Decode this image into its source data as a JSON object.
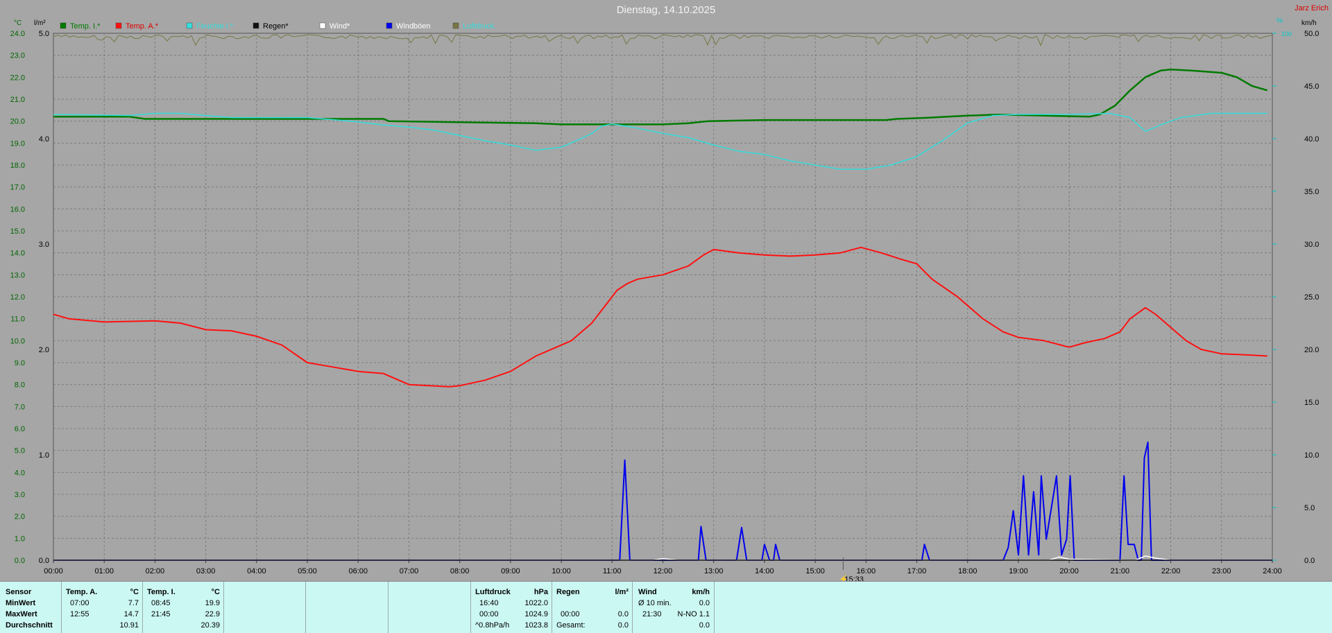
{
  "title": "Dienstag, 14.10.2025",
  "station": "Jarz Erich",
  "colors": {
    "background": "#a6a6a6",
    "temp_i": "#007a00",
    "temp_a": "#ff1010",
    "humidity": "#33dddd",
    "rain": "#111111",
    "wind": "#ffffff",
    "gusts": "#0000ee",
    "pressure": "#777744",
    "left_axis": "#006600",
    "rain_axis": "#000000",
    "right_axis": "#00c8c8",
    "station": "#dd0000"
  },
  "chart_data": {
    "type": "line",
    "axes": {
      "temp_unit": "°C",
      "temp_range": [
        0,
        24
      ],
      "rain_unit": "l/m²",
      "rain_range": [
        0,
        5
      ],
      "hum_unit": "%",
      "hum_range_label": "100",
      "wind_unit": "km/h",
      "wind_range": [
        0,
        50
      ],
      "temp_ticks": [
        "0.0",
        "1.0",
        "2.0",
        "3.0",
        "4.0",
        "5.0",
        "6.0",
        "7.0",
        "8.0",
        "9.0",
        "10.0",
        "11.0",
        "12.0",
        "13.0",
        "14.0",
        "15.0",
        "16.0",
        "17.0",
        "18.0",
        "19.0",
        "20.0",
        "21.0",
        "22.0",
        "23.0",
        "24.0"
      ],
      "rain_ticks": [
        "0.0",
        "1.0",
        "2.0",
        "3.0",
        "4.0",
        "5.0"
      ],
      "wind_ticks": [
        "0.0",
        "5.0",
        "10.0",
        "15.0",
        "20.0",
        "25.0",
        "30.0",
        "35.0",
        "40.0",
        "45.0",
        "50.0"
      ],
      "x_ticks": [
        "00:00",
        "01:00",
        "02:00",
        "03:00",
        "04:00",
        "05:00",
        "06:00",
        "07:00",
        "08:00",
        "09:00",
        "10:00",
        "11:00",
        "12:00",
        "13:00",
        "14:00",
        "15:00",
        "16:00",
        "17:00",
        "18:00",
        "19:00",
        "20:00",
        "21:00",
        "22:00",
        "23:00",
        "24:00"
      ],
      "x_range": [
        0,
        24
      ],
      "grid": true
    },
    "legend": [
      {
        "label": "Temp. I.*",
        "color": "#007a00",
        "text_color": "#007a00"
      },
      {
        "label": "Temp. A.*",
        "color": "#ff1010",
        "text_color": "#dd0000"
      },
      {
        "label": "Feuchte I.*",
        "color": "#33dddd",
        "text_color": "#33dddd"
      },
      {
        "label": "Regen*",
        "color": "#111111",
        "text_color": "#000000"
      },
      {
        "label": "Wind*",
        "color": "#ffffff",
        "text_color": "#ffffff"
      },
      {
        "label": "Windböen",
        "color": "#0000ee",
        "text_color": "#ffffff"
      },
      {
        "label": "Luftdruck",
        "color": "#777744",
        "text_color": "#33dddd"
      }
    ],
    "marker": {
      "label": "15:33",
      "x": 15.55
    },
    "series": [
      {
        "name": "Temp. I.*",
        "axis": "temp",
        "color": "#007a00",
        "width": 2.5,
        "points": [
          [
            0,
            20.2
          ],
          [
            1.5,
            20.2
          ],
          [
            1.8,
            20.1
          ],
          [
            3,
            20.1
          ],
          [
            6.5,
            20.1
          ],
          [
            6.6,
            20.0
          ],
          [
            8,
            19.95
          ],
          [
            9.5,
            19.9
          ],
          [
            10,
            19.85
          ],
          [
            11,
            19.85
          ],
          [
            12,
            19.85
          ],
          [
            12.5,
            19.9
          ],
          [
            12.9,
            20.0
          ],
          [
            14,
            20.05
          ],
          [
            16,
            20.05
          ],
          [
            16.4,
            20.05
          ],
          [
            16.6,
            20.1
          ],
          [
            17.2,
            20.15
          ],
          [
            18,
            20.25
          ],
          [
            18.6,
            20.3
          ],
          [
            19.5,
            20.25
          ],
          [
            20.4,
            20.2
          ],
          [
            20.6,
            20.3
          ],
          [
            20.9,
            20.7
          ],
          [
            21.2,
            21.4
          ],
          [
            21.5,
            22.0
          ],
          [
            21.8,
            22.3
          ],
          [
            22,
            22.35
          ],
          [
            22.4,
            22.3
          ],
          [
            23,
            22.2
          ],
          [
            23.3,
            22.0
          ],
          [
            23.6,
            21.6
          ],
          [
            23.9,
            21.4
          ]
        ]
      },
      {
        "name": "Temp. A.*",
        "axis": "temp",
        "color": "#ff1010",
        "width": 2,
        "points": [
          [
            0,
            11.2
          ],
          [
            0.3,
            11.0
          ],
          [
            1,
            10.85
          ],
          [
            2,
            10.9
          ],
          [
            2.5,
            10.8
          ],
          [
            3,
            10.5
          ],
          [
            3.5,
            10.45
          ],
          [
            4,
            10.2
          ],
          [
            4.5,
            9.8
          ],
          [
            5,
            9.0
          ],
          [
            5.5,
            8.8
          ],
          [
            6,
            8.6
          ],
          [
            6.5,
            8.5
          ],
          [
            7,
            8.0
          ],
          [
            7.4,
            7.95
          ],
          [
            7.8,
            7.9
          ],
          [
            8,
            7.95
          ],
          [
            8.5,
            8.2
          ],
          [
            9,
            8.6
          ],
          [
            9.5,
            9.3
          ],
          [
            10,
            9.8
          ],
          [
            10.2,
            10.0
          ],
          [
            10.6,
            10.8
          ],
          [
            10.9,
            11.7
          ],
          [
            11.1,
            12.3
          ],
          [
            11.3,
            12.6
          ],
          [
            11.5,
            12.8
          ],
          [
            12,
            13.0
          ],
          [
            12.5,
            13.4
          ],
          [
            12.8,
            13.9
          ],
          [
            13,
            14.15
          ],
          [
            13.5,
            14.0
          ],
          [
            14,
            13.9
          ],
          [
            14.5,
            13.85
          ],
          [
            15,
            13.9
          ],
          [
            15.5,
            14.0
          ],
          [
            15.9,
            14.25
          ],
          [
            16.3,
            14.0
          ],
          [
            16.7,
            13.7
          ],
          [
            17,
            13.5
          ],
          [
            17.3,
            12.8
          ],
          [
            17.8,
            12.0
          ],
          [
            18.3,
            11.0
          ],
          [
            18.7,
            10.4
          ],
          [
            19,
            10.15
          ],
          [
            19.5,
            10.0
          ],
          [
            20,
            9.7
          ],
          [
            20.3,
            9.9
          ],
          [
            20.7,
            10.1
          ],
          [
            21,
            10.4
          ],
          [
            21.2,
            11.0
          ],
          [
            21.5,
            11.5
          ],
          [
            21.7,
            11.2
          ],
          [
            22,
            10.6
          ],
          [
            22.3,
            10.0
          ],
          [
            22.6,
            9.6
          ],
          [
            23,
            9.4
          ],
          [
            23.5,
            9.35
          ],
          [
            23.9,
            9.3
          ]
        ]
      },
      {
        "name": "Feuchte I.*",
        "axis": "hum",
        "color": "#33dddd",
        "width": 1.5,
        "points": [
          [
            0,
            42.3
          ],
          [
            1.5,
            42.2
          ],
          [
            2,
            42.4
          ],
          [
            2.5,
            42.4
          ],
          [
            3,
            42.2
          ],
          [
            3.5,
            42.0
          ],
          [
            4,
            42.0
          ],
          [
            5,
            42.0
          ],
          [
            5.5,
            41.8
          ],
          [
            6,
            41.6
          ],
          [
            6.5,
            41.3
          ],
          [
            7,
            41.1
          ],
          [
            7.5,
            40.8
          ],
          [
            8,
            40.3
          ],
          [
            8.5,
            39.8
          ],
          [
            9,
            39.4
          ],
          [
            9.5,
            38.9
          ],
          [
            10,
            39.2
          ],
          [
            10.3,
            39.8
          ],
          [
            10.6,
            40.5
          ],
          [
            10.8,
            41.2
          ],
          [
            11,
            41.4
          ],
          [
            11.5,
            41.0
          ],
          [
            12,
            40.5
          ],
          [
            12.5,
            40.1
          ],
          [
            13,
            39.4
          ],
          [
            13.5,
            38.8
          ],
          [
            14,
            38.5
          ],
          [
            14.5,
            37.9
          ],
          [
            15,
            37.5
          ],
          [
            15.5,
            37.1
          ],
          [
            16,
            37.1
          ],
          [
            16.5,
            37.5
          ],
          [
            17,
            38.3
          ],
          [
            17.5,
            39.8
          ],
          [
            18,
            41.5
          ],
          [
            18.5,
            42.2
          ],
          [
            19,
            42.3
          ],
          [
            20,
            42.3
          ],
          [
            20.8,
            42.4
          ],
          [
            21.2,
            42.0
          ],
          [
            21.5,
            40.7
          ],
          [
            21.8,
            41.3
          ],
          [
            22.2,
            42.0
          ],
          [
            22.8,
            42.4
          ],
          [
            23.9,
            42.4
          ]
        ]
      },
      {
        "name": "Windböen",
        "axis": "wind",
        "color": "#0000ee",
        "width": 2,
        "points": [
          [
            0,
            0
          ],
          [
            11.15,
            0
          ],
          [
            11.25,
            9.5
          ],
          [
            11.35,
            0
          ],
          [
            12.7,
            0
          ],
          [
            12.75,
            3.2
          ],
          [
            12.85,
            0
          ],
          [
            13.45,
            0
          ],
          [
            13.55,
            3.1
          ],
          [
            13.65,
            0
          ],
          [
            13.95,
            0
          ],
          [
            14.0,
            1.5
          ],
          [
            14.1,
            0
          ],
          [
            14.18,
            0
          ],
          [
            14.22,
            1.5
          ],
          [
            14.3,
            0
          ],
          [
            17.1,
            0
          ],
          [
            17.15,
            1.5
          ],
          [
            17.25,
            0
          ],
          [
            18.7,
            0
          ],
          [
            18.8,
            1.2
          ],
          [
            18.9,
            4.7
          ],
          [
            19.0,
            0.5
          ],
          [
            19.1,
            8.0
          ],
          [
            19.2,
            0.5
          ],
          [
            19.3,
            6.5
          ],
          [
            19.4,
            0.5
          ],
          [
            19.45,
            8.0
          ],
          [
            19.55,
            2.0
          ],
          [
            19.75,
            8.0
          ],
          [
            19.85,
            0.5
          ],
          [
            19.95,
            2.0
          ],
          [
            20.02,
            8.0
          ],
          [
            20.1,
            0
          ],
          [
            21.0,
            0
          ],
          [
            21.08,
            8.0
          ],
          [
            21.16,
            1.5
          ],
          [
            21.28,
            1.5
          ],
          [
            21.36,
            0
          ],
          [
            21.42,
            0
          ],
          [
            21.48,
            9.7
          ],
          [
            21.55,
            11.2
          ],
          [
            21.62,
            0
          ],
          [
            24,
            0
          ]
        ]
      },
      {
        "name": "Wind*",
        "axis": "wind",
        "color": "#ffffff",
        "width": 1.5,
        "points": [
          [
            0,
            0
          ],
          [
            11.8,
            0
          ],
          [
            12.0,
            0.15
          ],
          [
            12.3,
            0
          ],
          [
            19.6,
            0
          ],
          [
            19.8,
            0.3
          ],
          [
            20.0,
            0.1
          ],
          [
            21.3,
            0
          ],
          [
            21.5,
            0.4
          ],
          [
            21.7,
            0.2
          ],
          [
            22.0,
            0
          ],
          [
            24,
            0
          ]
        ]
      },
      {
        "name": "Regen*",
        "axis": "rain",
        "color": "#111111",
        "width": 1.5,
        "points": [
          [
            0,
            0
          ],
          [
            24,
            0
          ]
        ]
      }
    ],
    "pressure_range_hpa": [
      1022.0,
      1024.9
    ]
  },
  "table": {
    "sensor": {
      "title": "Sensor",
      "rows": [
        "MinWert",
        "MaxWert",
        "Durchschnitt"
      ]
    },
    "temp_a": {
      "title": "Temp. A.",
      "unit": "°C",
      "rows": [
        [
          "07:00",
          "7.7"
        ],
        [
          "12:55",
          "14.7"
        ],
        [
          "",
          "10.91"
        ]
      ]
    },
    "temp_i": {
      "title": "Temp. I.",
      "unit": "°C",
      "rows": [
        [
          "08:45",
          "19.9"
        ],
        [
          "21:45",
          "22.9"
        ],
        [
          "",
          "20.39"
        ]
      ]
    },
    "pressure": {
      "title": "Luftdruck",
      "unit": "hPa",
      "rows": [
        [
          "16:40",
          "1022.0"
        ],
        [
          "00:00",
          "1024.9"
        ],
        [
          "^0.8hPa/h",
          "1023.8"
        ]
      ]
    },
    "rain": {
      "title": "Regen",
      "unit": "l/m²",
      "rows": [
        [
          "",
          ""
        ],
        [
          "00:00",
          "0.0"
        ],
        [
          "Gesamt:",
          "0.0"
        ]
      ]
    },
    "wind": {
      "title": "Wind",
      "unit": "km/h",
      "rows": [
        [
          "Ø 10 min.",
          "0.0"
        ],
        [
          "21:30",
          "N-NO 1.1"
        ],
        [
          "",
          "0.0"
        ]
      ]
    }
  }
}
